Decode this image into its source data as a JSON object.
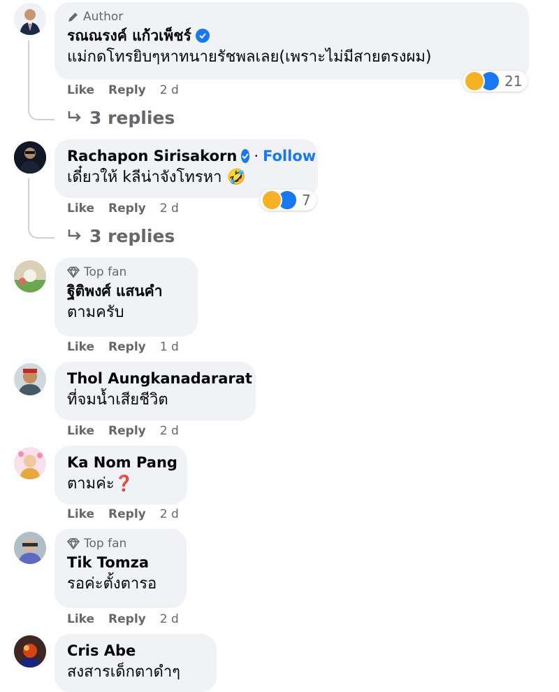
{
  "comments": [
    {
      "badge": "Author",
      "name": "รณณรงค์ แก้วเพ็ชร์",
      "verified": true,
      "text": "แม่กดโทรยิบๆหาทนายรัชพลเลย(เพราะไม่มีสายตรงผม)",
      "like": "Like",
      "reply": "Reply",
      "time": "2 d",
      "reactions": "21",
      "replies": "3 replies"
    },
    {
      "badge": "",
      "name": "Rachapon Sirisakorn",
      "verified": true,
      "follow": "Follow",
      "separator": "·",
      "text": "เดี๋ยวให้ kลีน่าจังโทรหา 🤣",
      "like": "Like",
      "reply": "Reply",
      "time": "2 d",
      "reactions": "7",
      "replies": "3 replies"
    },
    {
      "badge": "Top fan",
      "name": "ฐิติพงศ์ แสนคำ",
      "text": "ตามครับ",
      "like": "Like",
      "reply": "Reply",
      "time": "1 d"
    },
    {
      "badge": "",
      "name": "Thol Aungkanadararat",
      "text": "ที่จมน้ำเสียชีวิต",
      "like": "Like",
      "reply": "Reply",
      "time": "2 d"
    },
    {
      "badge": "",
      "name": "Ka Nom Pang",
      "text": "ตามค่ะ❓",
      "like": "Like",
      "reply": "Reply",
      "time": "2 d"
    },
    {
      "badge": "Top fan",
      "name": "Tik Tomza",
      "text": "รอค่ะตั้งตารอ",
      "like": "Like",
      "reply": "Reply",
      "time": "2 d"
    },
    {
      "badge": "",
      "name": "Cris Abe",
      "text": "สงสารเด็กตาดำๆ"
    }
  ],
  "icons": {
    "author_badge": "pencil-icon",
    "topfan_badge": "diamond-icon",
    "verified": "verified-check-icon",
    "reply_arrow": "reply-arrow-icon",
    "reaction_haha": "haha-reaction-icon",
    "reaction_like": "like-reaction-icon"
  },
  "colors": {
    "bubble": "#f0f2f5",
    "secondary_text": "#65676b",
    "link_blue": "#1877f2",
    "haha_yellow": "#f7b125"
  }
}
